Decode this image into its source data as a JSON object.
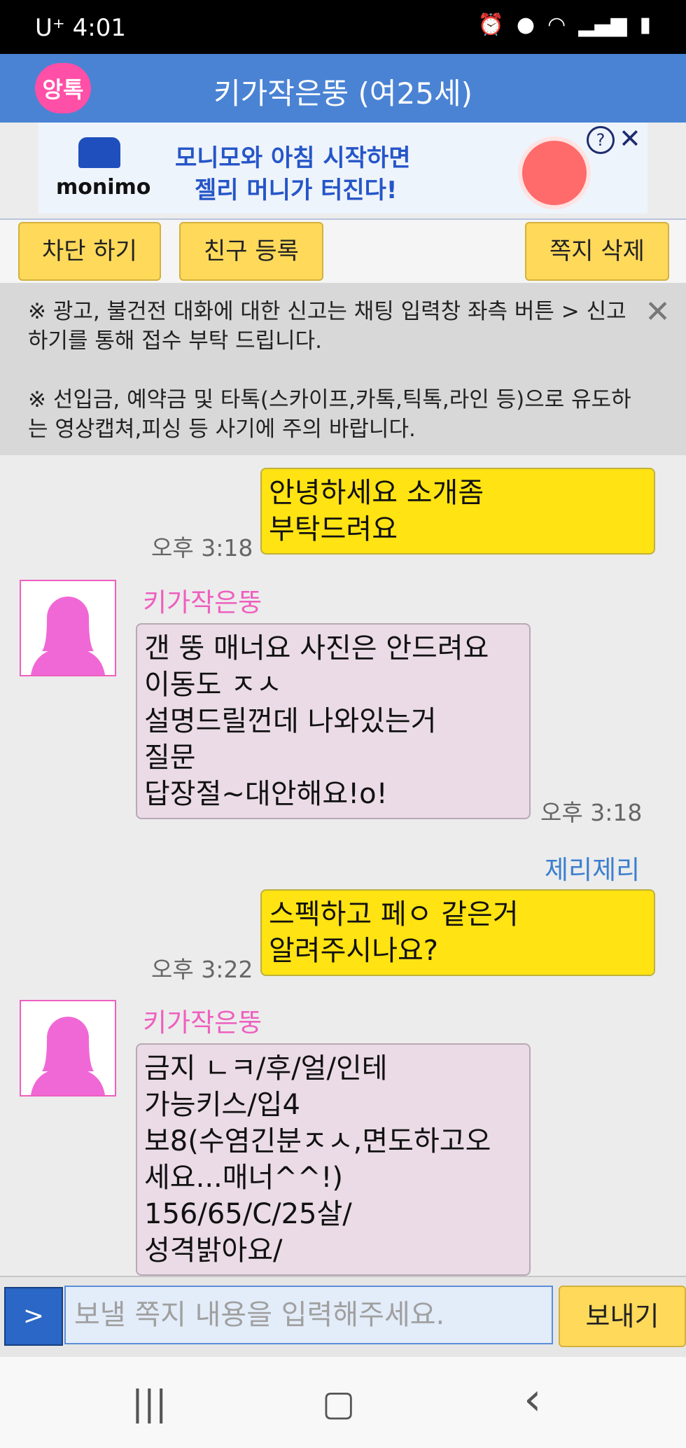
{
  "status_bar": {
    "carrier": "U⁺",
    "time": "4:01",
    "icons": [
      "alarm-icon",
      "location-icon",
      "wifi-icon",
      "signal-icon",
      "battery-icon"
    ]
  },
  "header": {
    "logo_text": "앙톡",
    "title": "키가작은뚱 (여25세)"
  },
  "ad": {
    "brand": "monimo",
    "line1": "모니모와 아침 시작하면",
    "line2": "젤리 머니가 터진다!",
    "info_glyph": "?",
    "close_glyph": "✕"
  },
  "toolbar": {
    "block_label": "차단 하기",
    "friend_label": "친구 등록",
    "delete_label": "쪽지 삭제"
  },
  "notice": {
    "line1": "※ 광고, 불건전 대화에 대한 신고는 채팅 입력창 좌측 버튼 > 신고하기를 통해 접수 부탁 드립니다.",
    "line2": "※ 선입금, 예약금 및 타톡(스카이프,카톡,틱톡,라인 등)으로 유도하는 영상캡쳐,피싱 등 사기에 주의 바랍니다.",
    "close_glyph": "✕"
  },
  "messages": [
    {
      "direction": "out",
      "time": "오후 3:18",
      "text": "안녕하세요 소개좀\n부탁드려요"
    },
    {
      "direction": "in",
      "sender": "키가작은뚱",
      "time": "오후 3:18",
      "text": "갠 뚱 매너요 사진은 안드려요\n이동도 ㅈㅅ\n설명드릴껀데 나와있는거\n질문\n답장절~대안해요!o!"
    },
    {
      "direction": "out",
      "sender": "제리제리",
      "time": "오후 3:22",
      "text": "스펙하고 페ㅇ 같은거\n알려주시나요?"
    },
    {
      "direction": "in",
      "sender": "키가작은뚱",
      "text": "금지 ㄴㅋ/후/얼/인테\n가능키스/입4\n보8(수염긴분ㅈㅅ,면도하고오\n세요...매너^^!)\n156/65/C/25살/\n성격밝아요/"
    }
  ],
  "input": {
    "toggle_glyph": ">",
    "placeholder": "보낼 쪽지 내용을 입력해주세요.",
    "send_label": "보내기"
  },
  "nav": {
    "recent_glyph": "|||",
    "home_glyph": "▢",
    "back_glyph": "‹"
  }
}
